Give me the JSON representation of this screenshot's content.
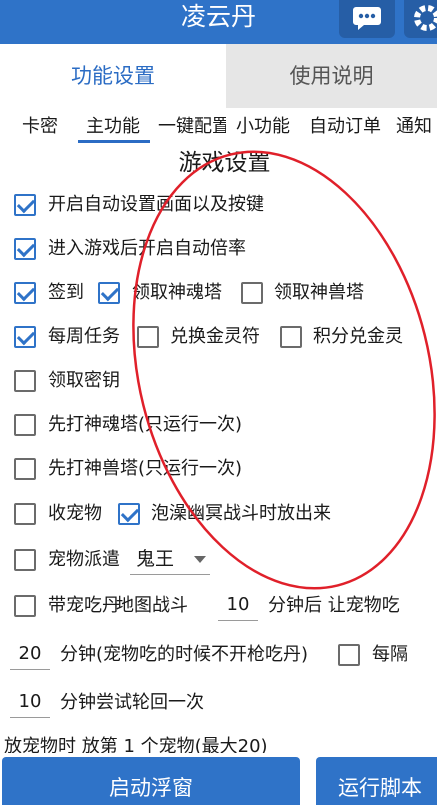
{
  "app": {
    "title": "凌云丹"
  },
  "tabs": [
    {
      "label": "功能设置",
      "active": true
    },
    {
      "label": "使用说明",
      "active": false
    }
  ],
  "subtabs": [
    {
      "label": "卡密"
    },
    {
      "label": "主功能",
      "active": true
    },
    {
      "label": "一键配置"
    },
    {
      "label": "小功能"
    },
    {
      "label": "自动订单"
    },
    {
      "label": "通知"
    }
  ],
  "section": {
    "title": "游戏设置"
  },
  "options": {
    "auto_setup": {
      "label": "开启自动设置画面以及按键",
      "checked": true
    },
    "auto_speed": {
      "label": "进入游戏后开启自动倍率",
      "checked": true
    },
    "signin": {
      "label": "签到",
      "checked": true
    },
    "soul_tower": {
      "label": "领取神魂塔",
      "checked": true
    },
    "beast_tower": {
      "label": "领取神兽塔",
      "checked": false
    },
    "weekly": {
      "label": "每周任务",
      "checked": true
    },
    "exchange_spirit": {
      "label": "兑换金灵符",
      "checked": false
    },
    "points_spirit": {
      "label": "积分兑金灵",
      "checked": false
    },
    "key": {
      "label": "领取密钥",
      "checked": false
    },
    "first_soul": {
      "label": "先打神魂塔(只运行一次)",
      "checked": false
    },
    "first_beast": {
      "label": "先打神兽塔(只运行一次)",
      "checked": false
    },
    "collect_pet": {
      "label": "收宠物",
      "checked": false
    },
    "release_pet": {
      "label": "泡澡幽冥战斗时放出来",
      "checked": true
    },
    "pet_dispatch": {
      "label": "宠物派遣",
      "checked": false,
      "selected": "鬼王"
    },
    "pet_pill": {
      "label": "带宠吃丹",
      "checked": false
    },
    "interval": {
      "label": "每隔",
      "checked": false
    }
  },
  "pet_pill": {
    "map_fight_label": "地图战斗",
    "minutes_value": "10",
    "after_label": "分钟后 让宠物吃",
    "minutes2_value": "20",
    "note_label": "分钟(宠物吃的时候不开枪吃丹)",
    "retry_value": "10",
    "retry_label": "分钟尝试轮回一次"
  },
  "cutoff_text": "放宠物时 放第   1    个宠物(最大20)",
  "buttons": {
    "float": "启动浮窗",
    "run": "运行脚本"
  },
  "colors": {
    "primary": "#2f73c8",
    "annotation": "#e0202a"
  }
}
